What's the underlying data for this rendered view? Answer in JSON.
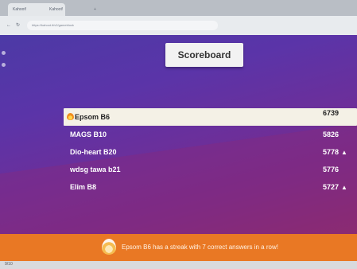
{
  "browser": {
    "tabs": [
      {
        "label": "Kahoot!"
      },
      {
        "label": "Kahoot!"
      },
      {
        "label": "+"
      }
    ],
    "back_icon": "arrow-left-icon",
    "reload_icon": "reload-icon",
    "url": "https://kahoot.it/v2/gameblock"
  },
  "scoreboard": {
    "title": "Scoreboard",
    "players": [
      {
        "name": "Epsom B6",
        "score": "6739",
        "leader": true,
        "icon": "flame-icon"
      },
      {
        "name": "MAGS B10",
        "score": "5826"
      },
      {
        "name": "Dio-heart B20",
        "score": "5778",
        "icon": "thumbs-up-icon",
        "icon_glyph": "▲"
      },
      {
        "name": "wdsg tawa b21",
        "score": "5776"
      },
      {
        "name": "Elim B8",
        "score": "5727",
        "icon": "thumbs-up-icon",
        "icon_glyph": "▲"
      }
    ]
  },
  "streak": {
    "message": "Epsom B6 has a streak with 7 correct answers in a row!",
    "icon": "flame-icon"
  },
  "status": {
    "counter": "9/10"
  },
  "colors": {
    "banner": "#e97824",
    "background_top": "#4c3aa6",
    "background_bottom": "#8b2d6e",
    "leader_row": "#f4f1e6"
  }
}
